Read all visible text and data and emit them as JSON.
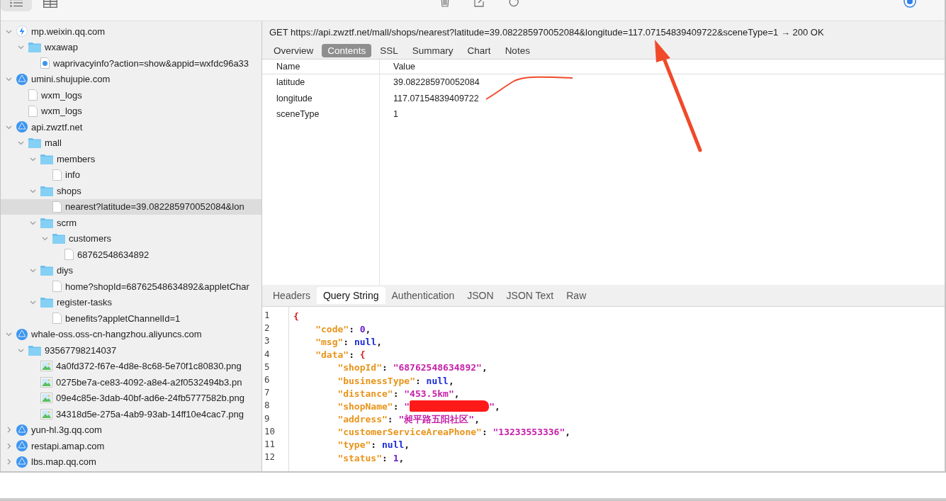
{
  "toolbar": {
    "views": [
      {
        "kind": "list",
        "selected": true
      },
      {
        "kind": "grid",
        "selected": false
      }
    ],
    "actions": [
      {
        "kind": "trash"
      },
      {
        "kind": "edit"
      },
      {
        "kind": "refresh"
      }
    ],
    "record": {
      "on": true
    }
  },
  "sidebar": {
    "items": [
      {
        "label": "mp.weixin.qq.com",
        "kind": "app",
        "expanded": true,
        "selected": false,
        "children": [
          {
            "label": "wxawap",
            "kind": "folder",
            "expanded": true,
            "selected": false,
            "children": [
              {
                "label": "waprivacyinfo?action=show&appid=wxfdc96a33",
                "kind": "page",
                "selected": false
              }
            ]
          }
        ]
      },
      {
        "label": "umini.shujupie.com",
        "kind": "host",
        "expanded": true,
        "selected": false,
        "children": [
          {
            "label": "wxm_logs",
            "kind": "json",
            "selected": false
          },
          {
            "label": "wxm_logs",
            "kind": "json",
            "selected": false
          }
        ]
      },
      {
        "label": "api.zwztf.net",
        "kind": "host",
        "expanded": true,
        "selected": false,
        "children": [
          {
            "label": "mall",
            "kind": "folder",
            "expanded": true,
            "selected": false,
            "children": [
              {
                "label": "members",
                "kind": "folder",
                "expanded": true,
                "selected": false,
                "children": [
                  {
                    "label": "info",
                    "kind": "json",
                    "selected": false
                  }
                ]
              },
              {
                "label": "shops",
                "kind": "folder",
                "expanded": true,
                "selected": false,
                "children": [
                  {
                    "label": "nearest?latitude=39.082285970052084&lon",
                    "kind": "json",
                    "selected": true
                  }
                ]
              },
              {
                "label": "scrm",
                "kind": "folder",
                "expanded": true,
                "selected": false,
                "children": [
                  {
                    "label": "customers",
                    "kind": "folder",
                    "expanded": true,
                    "selected": false,
                    "children": [
                      {
                        "label": "68762548634892",
                        "kind": "json",
                        "selected": false
                      }
                    ]
                  }
                ]
              },
              {
                "label": "diys",
                "kind": "folder",
                "expanded": true,
                "selected": false,
                "children": [
                  {
                    "label": "home?shopId=68762548634892&appletChar",
                    "kind": "json",
                    "selected": false
                  }
                ]
              },
              {
                "label": "register-tasks",
                "kind": "folder",
                "expanded": true,
                "selected": false,
                "children": [
                  {
                    "label": "benefits?appletChannelId=1",
                    "kind": "json",
                    "selected": false
                  }
                ]
              }
            ]
          }
        ]
      },
      {
        "label": "whale-oss.oss-cn-hangzhou.aliyuncs.com",
        "kind": "host",
        "expanded": true,
        "selected": false,
        "children": [
          {
            "label": "93567798214037",
            "kind": "folder",
            "expanded": true,
            "selected": false,
            "children": [
              {
                "label": "4a0fd372-f67e-4d8e-8c68-5e70f1c80830.png",
                "kind": "image",
                "selected": false
              },
              {
                "label": "0275be7a-ce83-4092-a8e4-a2f0532494b3.pn",
                "kind": "image",
                "selected": false
              },
              {
                "label": "09e4c85e-3dab-40bf-ad6e-24fb5777582b.png",
                "kind": "image",
                "selected": false
              },
              {
                "label": "34318d5e-275a-4ab9-93ab-14ff10e4cac7.png",
                "kind": "image",
                "selected": false
              }
            ]
          }
        ]
      },
      {
        "label": "yun-hl.3g.qq.com",
        "kind": "host",
        "expanded": false,
        "selected": false
      },
      {
        "label": "restapi.amap.com",
        "kind": "host",
        "expanded": false,
        "selected": false
      },
      {
        "label": "lbs.map.qq.com",
        "kind": "host",
        "expanded": false,
        "selected": false
      }
    ]
  },
  "request": {
    "summary": "GET https://api.zwztf.net/mall/shops/nearest?latitude=39.082285970052084&longitude=117.07154839409722&sceneType=1 → 200 OK"
  },
  "top_tabs": [
    {
      "label": "Overview",
      "selected": false
    },
    {
      "label": "Contents",
      "selected": true
    },
    {
      "label": "SSL",
      "selected": false
    },
    {
      "label": "Summary",
      "selected": false
    },
    {
      "label": "Chart",
      "selected": false
    },
    {
      "label": "Notes",
      "selected": false
    }
  ],
  "params_table": {
    "columns": [
      "Name",
      "Value"
    ],
    "rows": [
      {
        "name": "latitude",
        "value": "39.082285970052084"
      },
      {
        "name": "longitude",
        "value": "117.07154839409722"
      },
      {
        "name": "sceneType",
        "value": "1"
      }
    ]
  },
  "bottom_tabs": [
    {
      "label": "Headers",
      "selected": false
    },
    {
      "label": "Query String",
      "selected": true
    },
    {
      "label": "Authentication",
      "selected": false
    },
    {
      "label": "JSON",
      "selected": false
    },
    {
      "label": "JSON Text",
      "selected": false
    },
    {
      "label": "Raw",
      "selected": false
    }
  ],
  "code": {
    "lines": [
      {
        "number": "1",
        "tokens": [
          {
            "kind": "brace",
            "text": "{"
          }
        ],
        "children": [
          {
            "number": "2",
            "tokens": [
              {
                "kind": "key",
                "text": "\"code\""
              },
              {
                "kind": "punct",
                "text": ":"
              },
              {
                "kind": "number",
                "text": "0"
              },
              {
                "kind": "punct",
                "text": ","
              }
            ]
          },
          {
            "number": "3",
            "tokens": [
              {
                "kind": "key",
                "text": "\"msg\""
              },
              {
                "kind": "punct",
                "text": ":"
              },
              {
                "kind": "null",
                "text": "null"
              },
              {
                "kind": "punct",
                "text": ","
              }
            ]
          },
          {
            "number": "4",
            "tokens": [
              {
                "kind": "key",
                "text": "\"data\""
              },
              {
                "kind": "punct",
                "text": ":"
              },
              {
                "kind": "brace",
                "text": "{"
              }
            ],
            "children": [
              {
                "number": "5",
                "tokens": [
                  {
                    "kind": "key",
                    "text": "\"shopId\""
                  },
                  {
                    "kind": "punct",
                    "text": ":"
                  },
                  {
                    "kind": "string",
                    "text": "\"68762548634892\""
                  },
                  {
                    "kind": "punct",
                    "text": ","
                  }
                ]
              },
              {
                "number": "6",
                "tokens": [
                  {
                    "kind": "key",
                    "text": "\"businessType\""
                  },
                  {
                    "kind": "punct",
                    "text": ":"
                  },
                  {
                    "kind": "null",
                    "text": "null"
                  },
                  {
                    "kind": "punct",
                    "text": ","
                  }
                ]
              },
              {
                "number": "7",
                "tokens": [
                  {
                    "kind": "key",
                    "text": "\"distance\""
                  },
                  {
                    "kind": "punct",
                    "text": ":"
                  },
                  {
                    "kind": "string",
                    "text": "\"453.5km\""
                  },
                  {
                    "kind": "punct",
                    "text": ","
                  }
                ]
              },
              {
                "number": "8",
                "tokens": [
                  {
                    "kind": "key",
                    "text": "\"shopName\""
                  },
                  {
                    "kind": "punct",
                    "text": ":"
                  },
                  {
                    "kind": "string",
                    "text": "\""
                  },
                  {
                    "kind": "redaction"
                  },
                  {
                    "kind": "string",
                    "text": "\""
                  },
                  {
                    "kind": "punct",
                    "text": ","
                  }
                ]
              },
              {
                "number": "9",
                "tokens": [
                  {
                    "kind": "key",
                    "text": "\"address\""
                  },
                  {
                    "kind": "punct",
                    "text": ":"
                  },
                  {
                    "kind": "string",
                    "text": "\"昶平路五阳社区\""
                  },
                  {
                    "kind": "punct",
                    "text": ","
                  }
                ]
              },
              {
                "number": "10",
                "tokens": [
                  {
                    "kind": "key",
                    "text": "\"customerServiceAreaPhone\""
                  },
                  {
                    "kind": "punct",
                    "text": ":"
                  },
                  {
                    "kind": "string",
                    "text": "\"13233553336\""
                  },
                  {
                    "kind": "punct",
                    "text": ","
                  }
                ]
              },
              {
                "number": "11",
                "tokens": [
                  {
                    "kind": "key",
                    "text": "\"type\""
                  },
                  {
                    "kind": "punct",
                    "text": ":"
                  },
                  {
                    "kind": "null",
                    "text": "null"
                  },
                  {
                    "kind": "punct",
                    "text": ","
                  }
                ]
              },
              {
                "number": "12",
                "tokens": [
                  {
                    "kind": "key",
                    "text": "\"status\""
                  },
                  {
                    "kind": "punct",
                    "text": ":"
                  },
                  {
                    "kind": "number",
                    "text": "1"
                  },
                  {
                    "kind": "punct",
                    "text": ","
                  }
                ]
              }
            ]
          }
        ]
      }
    ]
  }
}
